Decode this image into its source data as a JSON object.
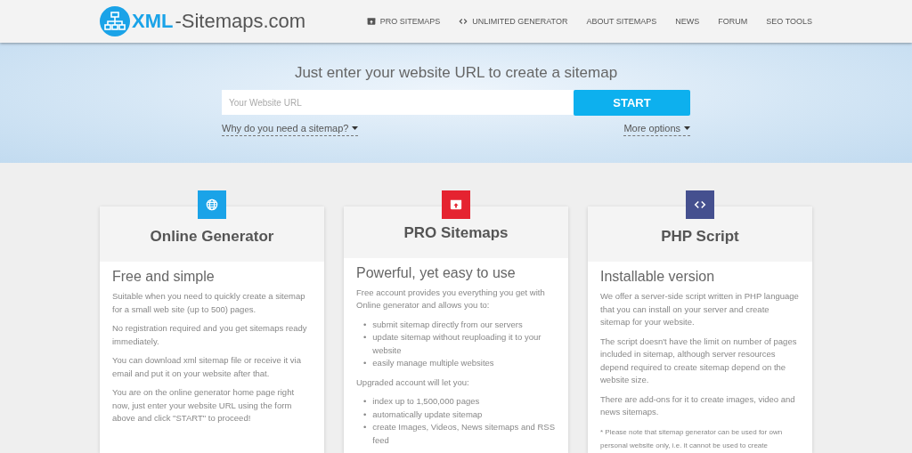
{
  "logo": {
    "brand": "XML",
    "suffix": "-Sitemaps.com"
  },
  "nav": [
    {
      "label": "PRO SITEMAPS"
    },
    {
      "label": "UNLIMITED GENERATOR"
    },
    {
      "label": "ABOUT SITEMAPS"
    },
    {
      "label": "NEWS"
    },
    {
      "label": "FORUM"
    },
    {
      "label": "SEO TOOLS"
    }
  ],
  "hero": {
    "title": "Just enter your website URL to create a sitemap",
    "placeholder": "Your Website URL",
    "button": "START",
    "links": [
      "Why do you need a sitemap?",
      "More options"
    ]
  },
  "cards": [
    {
      "color": "#1aa3e8",
      "title": "Online Generator",
      "subtitle": "Free and simple",
      "content": [
        {
          "kind": "paragraph",
          "text": "Suitable when you need to quickly create a sitemap for a small web site (up to 500) pages."
        },
        {
          "kind": "paragraph",
          "text": "No registration required and you get sitemaps ready immediately."
        },
        {
          "kind": "paragraph",
          "text": "You can download xml sitemap file or receive it via email and put it on your website after that."
        },
        {
          "kind": "paragraph",
          "text": "You are on the online generator home page right now, just enter your website URL using the form above and click \"START\" to proceed!"
        }
      ]
    },
    {
      "color": "#e52330",
      "title": "PRO Sitemaps",
      "subtitle": "Powerful, yet easy to use",
      "content": [
        {
          "kind": "paragraph",
          "text": "Free account provides you everything you get with Online generator and allows you to:"
        },
        {
          "kind": "list",
          "items": [
            {
              "bullet": "•",
              "text": "submit sitemap directly from our servers"
            },
            {
              "bullet": "•",
              "text": "update sitemap without reuploading it to your website"
            },
            {
              "bullet": "•",
              "text": "easily manage multiple websites"
            }
          ]
        },
        {
          "kind": "paragraph",
          "text": "Upgraded account will let you:"
        },
        {
          "kind": "list",
          "items": [
            {
              "bullet": "•",
              "text": "index up to 1,500,000 pages"
            },
            {
              "bullet": "•",
              "text": "automatically update sitemap"
            },
            {
              "bullet": "•",
              "text": "create Images, Videos, News sitemaps and RSS feed"
            }
          ]
        }
      ]
    },
    {
      "color": "#45508f",
      "title": "PHP Script",
      "subtitle": "Installable version",
      "content": [
        {
          "kind": "paragraph",
          "text": "We offer a server-side script written in PHP language that you can install on your server and create sitemap for your website."
        },
        {
          "kind": "paragraph",
          "text": "The script doesn't have the limit on number of pages included in sitemap, although server resources depend required to create sitemap depend on the website size."
        },
        {
          "kind": "paragraph",
          "text": "There are add-ons for it to create images, video and news sitemaps."
        },
        {
          "kind": "note",
          "text": "* Please note that sitemap generator can be used for own personal website only, i.e. it cannot be used to create"
        }
      ]
    }
  ]
}
